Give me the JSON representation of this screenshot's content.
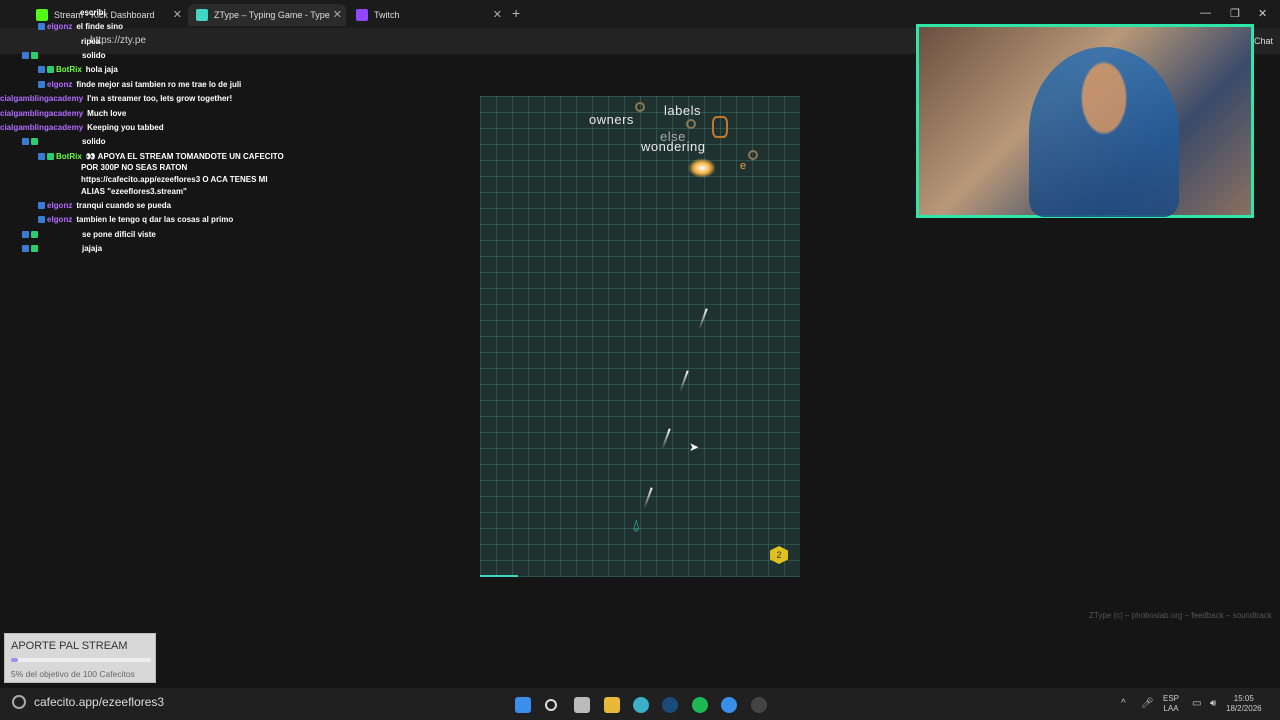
{
  "tabs": [
    {
      "label": "Stream - Kick Dashboard",
      "active": false
    },
    {
      "label": "ZType – Typing Game - Type to Sh",
      "active": true
    },
    {
      "label": "Twitch",
      "active": false
    }
  ],
  "address_bar": {
    "url": "https://zty.pe"
  },
  "chat_button": "Chat",
  "chat_overlay": [
    {
      "user": "",
      "text": "escribi"
    },
    {
      "user": "elgonz",
      "text": "el finde sino"
    },
    {
      "user": "",
      "text": "ripea"
    },
    {
      "user": "",
      "text": "solido"
    },
    {
      "user": "BotRix",
      "text": "hola jaja"
    },
    {
      "user": "elgonz",
      "text": "finde mejor asi tambien ro me trae lo de juli"
    },
    {
      "user": "cialgamblingacademy",
      "text": "I'm a streamer too, lets grow together!"
    },
    {
      "user": "cialgamblingacademy",
      "text": "Much love"
    },
    {
      "user": "cialgamblingacademy",
      "text": "Keeping you tabbed"
    },
    {
      "user": "",
      "text": "solido"
    },
    {
      "user": "BotRix",
      "text": "👀 APOYA EL STREAM TOMANDOTE UN CAFECITO"
    },
    {
      "user": "",
      "text": "POR 300P NO SEAS RATON"
    },
    {
      "user": "",
      "text": "https://cafecito.app/ezeeflores3 O ACA TENES MI"
    },
    {
      "user": "",
      "text": "ALIAS \"ezeeflores3.stream\""
    },
    {
      "user": "elgonz",
      "text": "tranqui cuando se pueda"
    },
    {
      "user": "elgonz",
      "text": "tambien le tengo q dar las cosas al primo"
    },
    {
      "user": "",
      "text": "se pone dificil viste"
    },
    {
      "user": "",
      "text": "jajaja"
    }
  ],
  "game": {
    "words": [
      {
        "text": "owners"
      },
      {
        "text": "labels"
      },
      {
        "text": "else"
      },
      {
        "text": "wondering"
      },
      {
        "text": "e"
      }
    ],
    "level": "2",
    "footer": "ZType (c) – phoboslab.org – feedback – soundtrack"
  },
  "donation": {
    "title": "APORTE PAL STREAM",
    "progress_percent": 5,
    "subtitle": "5% del objetivo de 100 Cafecitos"
  },
  "taskbar": {
    "url": "cafecito.app/ezeeflores3",
    "lang_top": "ESP",
    "lang_bottom": "LAA",
    "time": "15:05",
    "date": "18/2/2026"
  },
  "colors": {
    "accent": "#2ee6a8",
    "username": "#b36bff",
    "botrix": "#6cff3c"
  }
}
